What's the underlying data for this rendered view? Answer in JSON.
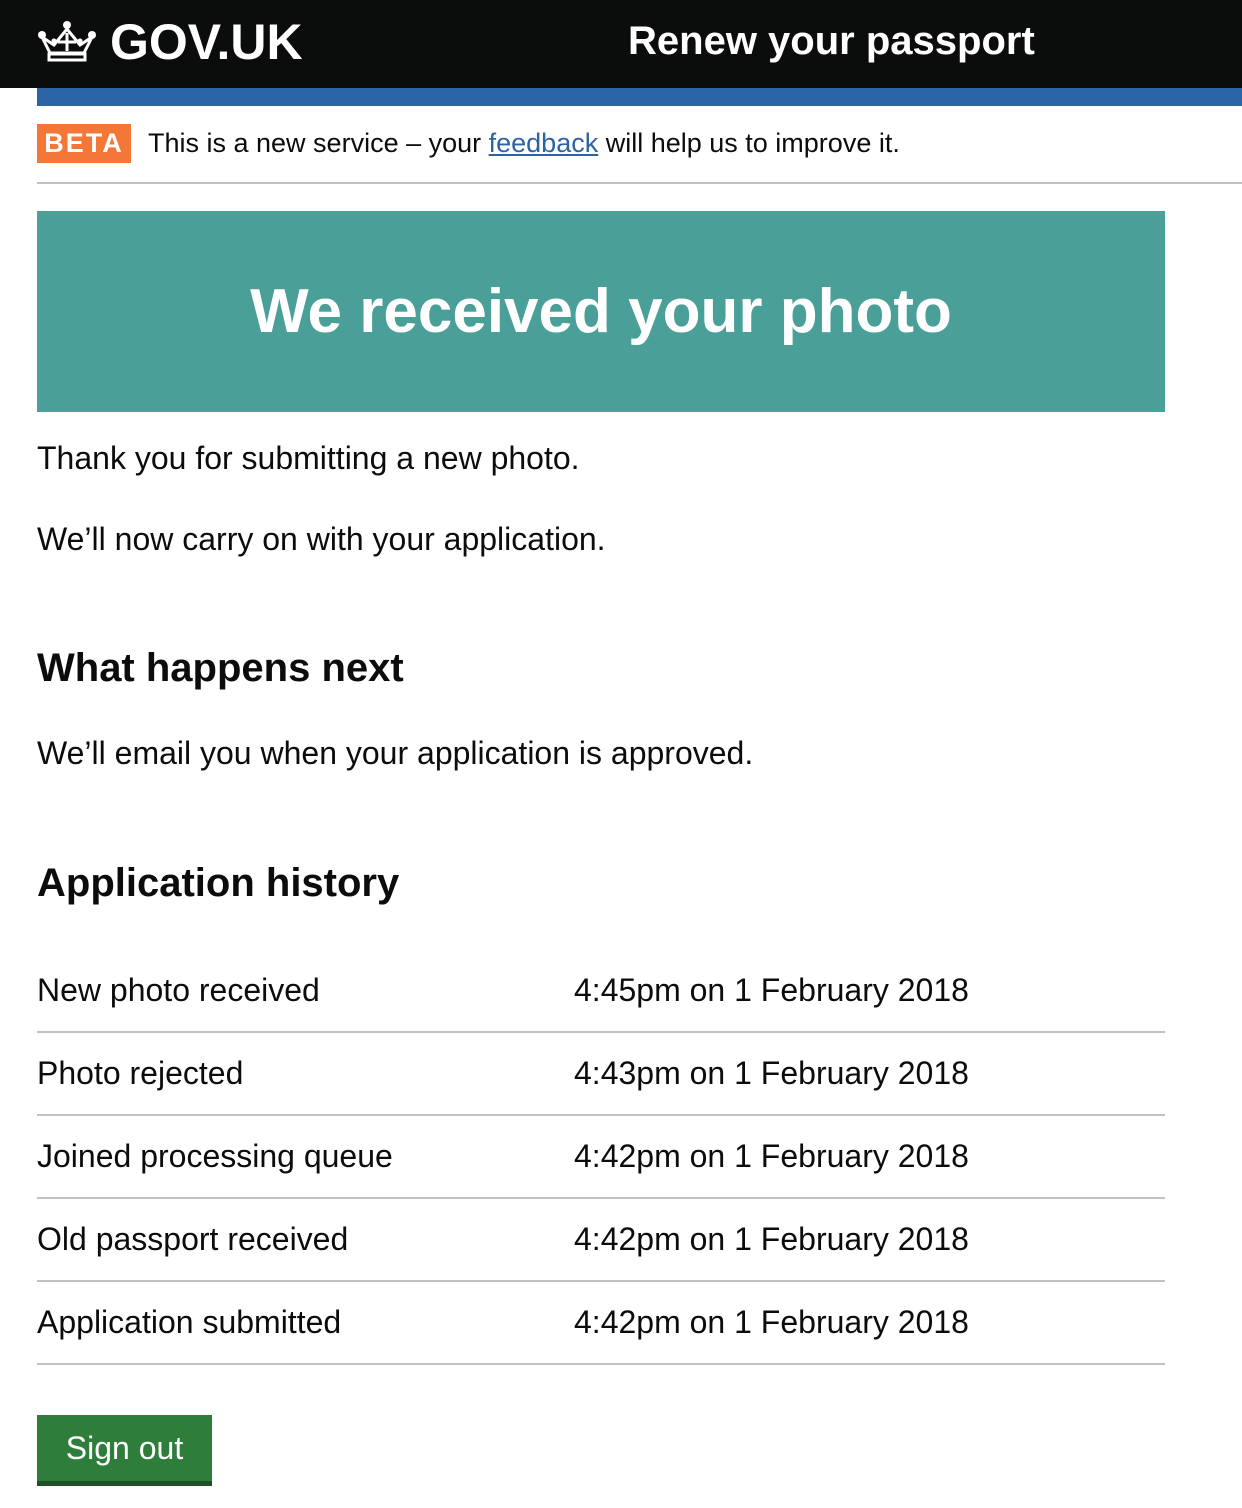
{
  "header": {
    "logo_text": "GOV.UK",
    "logo_icon": "crown-icon",
    "service_name": "Renew your passport",
    "bar_color": "#2b64a5"
  },
  "phase_banner": {
    "tag": "BETA",
    "tag_color": "#f47738",
    "text_before": "This is a new service – your ",
    "link_text": "feedback",
    "text_after": " will help us to improve it."
  },
  "confirmation": {
    "title": "We received your photo",
    "color": "#4aa098"
  },
  "content": {
    "thanks": "Thank you for submitting a new photo.",
    "continue": "We’ll now carry on with your application.",
    "next_heading": "What happens next",
    "next_text": "We’ll email you when your application is approved.",
    "history_heading": "Application history"
  },
  "history": [
    {
      "event": "New photo received",
      "time": "4:45pm on 1 February 2018"
    },
    {
      "event": "Photo rejected",
      "time": "4:43pm on 1 February 2018"
    },
    {
      "event": "Joined processing queue",
      "time": "4:42pm on 1 February 2018"
    },
    {
      "event": "Old passport received",
      "time": "4:42pm on 1 February 2018"
    },
    {
      "event": "Application submitted",
      "time": "4:42pm on 1 February 2018"
    }
  ],
  "actions": {
    "sign_out": "Sign out",
    "button_color": "#2f7d3b"
  }
}
